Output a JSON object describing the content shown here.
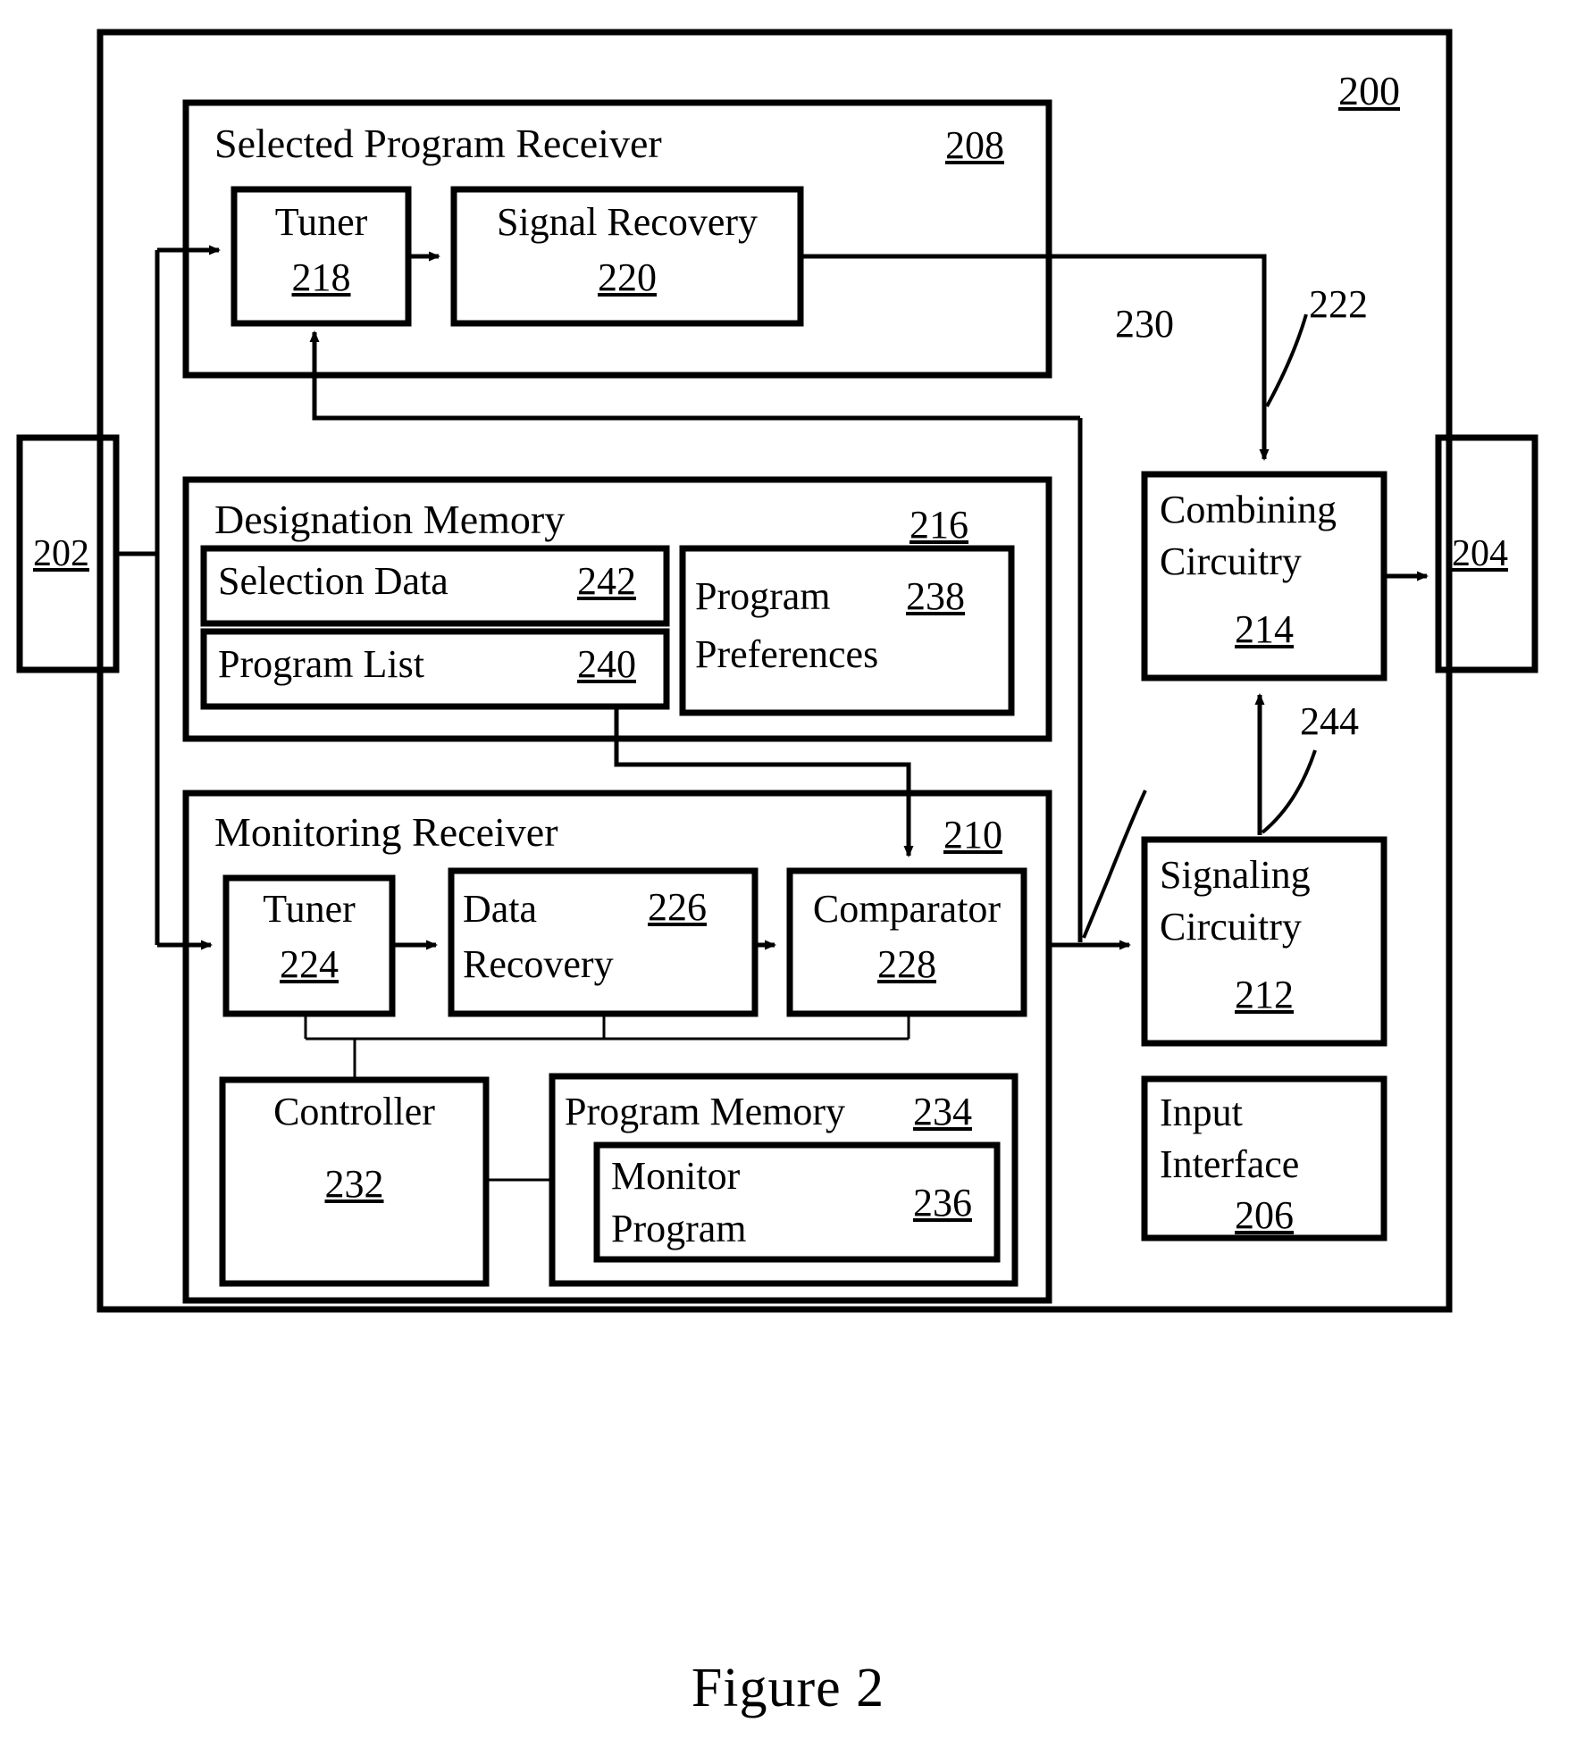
{
  "figure": {
    "caption": "Figure 2",
    "system_ref": "200"
  },
  "external": {
    "input_port_ref": "202",
    "output_port_ref": "204"
  },
  "blocks": {
    "selected_program_receiver": {
      "title": "Selected Program Receiver",
      "ref": "208",
      "children": [
        {
          "title": "Tuner",
          "ref": "218"
        },
        {
          "title": "Signal Recovery",
          "ref": "220"
        }
      ]
    },
    "designation_memory": {
      "title": "Designation Memory",
      "ref": "216",
      "children": [
        {
          "title": "Selection Data",
          "ref": "242"
        },
        {
          "title": "Program List",
          "ref": "240"
        },
        {
          "title_line1": "Program",
          "title_line2": "Preferences",
          "ref": "238"
        }
      ]
    },
    "monitoring_receiver": {
      "title": "Monitoring Receiver",
      "ref": "210",
      "children": [
        {
          "title": "Tuner",
          "ref": "224"
        },
        {
          "title_line1": "Data",
          "title_line2": "Recovery",
          "ref": "226"
        },
        {
          "title": "Comparator",
          "ref": "228"
        },
        {
          "title": "Controller",
          "ref": "232"
        },
        {
          "title": "Program Memory",
          "ref": "234"
        },
        {
          "title_line1": "Monitor",
          "title_line2": "Program",
          "ref": "236"
        }
      ]
    },
    "combining_circuitry": {
      "title_line1": "Combining",
      "title_line2": "Circuitry",
      "ref": "214"
    },
    "signaling_circuitry": {
      "title_line1": "Signaling",
      "title_line2": "Circuitry",
      "ref": "212"
    },
    "input_interface": {
      "title_line1": "Input",
      "title_line2": "Interface",
      "ref": "206"
    }
  },
  "connector_refs": {
    "selected_program_path": "230",
    "combining_input_path": "222",
    "signaling_to_combining_path": "244"
  },
  "colors": {
    "ink": "#000000",
    "paper": "#ffffff"
  }
}
